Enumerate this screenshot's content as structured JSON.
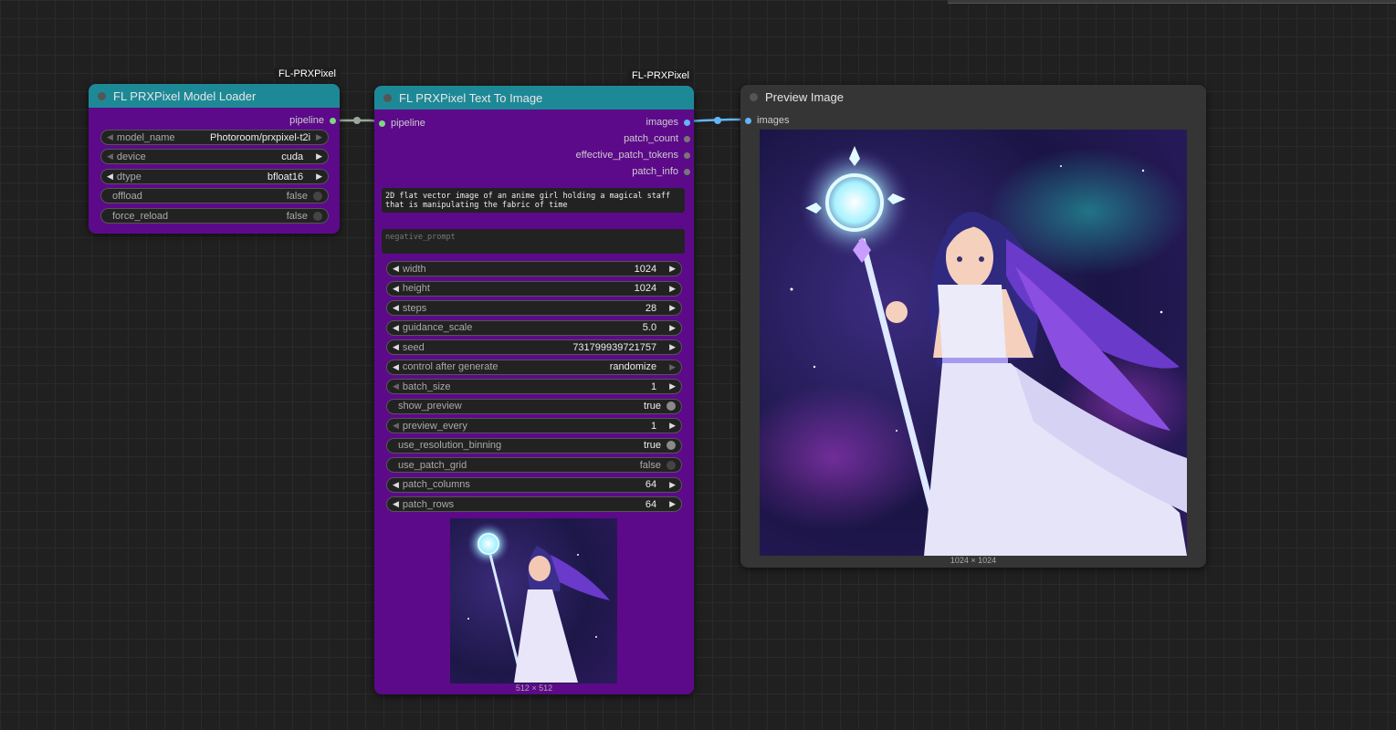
{
  "nodes": {
    "loader": {
      "badge": "FL-PRXPixel",
      "title": "FL PRXPixel Model Loader",
      "output": "pipeline",
      "widgets": [
        {
          "label": "model_name",
          "value": "Photoroom/prxpixel-t2i"
        },
        {
          "label": "device",
          "value": "cuda"
        },
        {
          "label": "dtype",
          "value": "bfloat16"
        },
        {
          "label": "offload",
          "value": "false"
        },
        {
          "label": "force_reload",
          "value": "false"
        }
      ]
    },
    "t2i": {
      "badge": "FL-PRXPixel",
      "title": "FL PRXPixel Text To Image",
      "input": "pipeline",
      "outputs": [
        "images",
        "patch_count",
        "effective_patch_tokens",
        "patch_info"
      ],
      "prompt": "2D flat vector image of an anime girl holding a magical staff that is manipulating the fabric of time",
      "negative_placeholder": "negative_prompt",
      "widgets": [
        {
          "label": "width",
          "value": "1024"
        },
        {
          "label": "height",
          "value": "1024"
        },
        {
          "label": "steps",
          "value": "28"
        },
        {
          "label": "guidance_scale",
          "value": "5.0"
        },
        {
          "label": "seed",
          "value": "731799939721757"
        },
        {
          "label": "control after generate",
          "value": "randomize"
        },
        {
          "label": "batch_size",
          "value": "1"
        },
        {
          "label": "show_preview",
          "value": "true"
        },
        {
          "label": "preview_every",
          "value": "1"
        },
        {
          "label": "use_resolution_binning",
          "value": "true"
        },
        {
          "label": "use_patch_grid",
          "value": "false"
        },
        {
          "label": "patch_columns",
          "value": "64"
        },
        {
          "label": "patch_rows",
          "value": "64"
        }
      ],
      "preview_caption": "512 × 512"
    },
    "preview": {
      "title": "Preview Image",
      "input": "images",
      "caption": "1024 × 1024"
    }
  },
  "colors": {
    "node_body": "#5c0a8a",
    "node_header": "#1d8996",
    "link_pipeline": "#9aa89a",
    "link_images": "#64b5f6"
  },
  "icons": [
    "left-arrow-icon",
    "right-arrow-icon",
    "toggle-icon",
    "node-status-dot-icon"
  ]
}
